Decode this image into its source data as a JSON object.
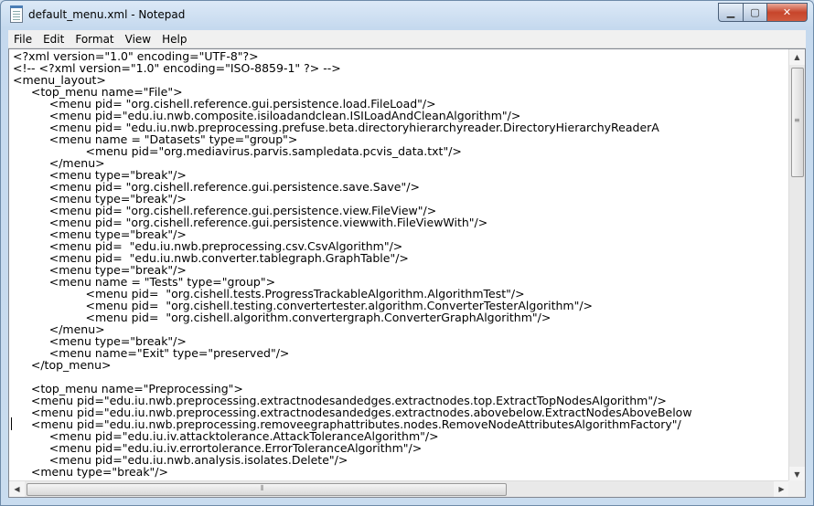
{
  "window": {
    "title": "default_menu.xml - Notepad"
  },
  "titlebar_buttons": {
    "minimize": "▁",
    "maximize": "▢",
    "close": "✕"
  },
  "menubar": {
    "items": [
      "File",
      "Edit",
      "Format",
      "View",
      "Help"
    ]
  },
  "editor": {
    "lines": [
      "<?xml version=\"1.0\" encoding=\"UTF-8\"?>",
      "<!-- <?xml version=\"1.0\" encoding=\"ISO-8859-1\" ?> -->",
      "<menu_layout>",
      "     <top_menu name=\"File\">",
      "          <menu pid= \"org.cishell.reference.gui.persistence.load.FileLoad\"/>",
      "          <menu pid=\"edu.iu.nwb.composite.isiloadandclean.ISILoadAndCleanAlgorithm\"/>",
      "          <menu pid= \"edu.iu.nwb.preprocessing.prefuse.beta.directoryhierarchyreader.DirectoryHierarchyReaderA",
      "          <menu name = \"Datasets\" type=\"group\">",
      "                    <menu pid=\"org.mediavirus.parvis.sampledata.pcvis_data.txt\"/>",
      "          </menu>",
      "          <menu type=\"break\"/>",
      "          <menu pid= \"org.cishell.reference.gui.persistence.save.Save\"/>",
      "          <menu type=\"break\"/>",
      "          <menu pid= \"org.cishell.reference.gui.persistence.view.FileView\"/>",
      "          <menu pid= \"org.cishell.reference.gui.persistence.viewwith.FileViewWith\"/>",
      "          <menu type=\"break\"/>",
      "          <menu pid=  \"edu.iu.nwb.preprocessing.csv.CsvAlgorithm\"/>",
      "          <menu pid=  \"edu.iu.nwb.converter.tablegraph.GraphTable\"/>",
      "          <menu type=\"break\"/>",
      "          <menu name = \"Tests\" type=\"group\">",
      "                    <menu pid=  \"org.cishell.tests.ProgressTrackableAlgorithm.AlgorithmTest\"/>",
      "                    <menu pid=  \"org.cishell.testing.convertertester.algorithm.ConverterTesterAlgorithm\"/>",
      "                    <menu pid=  \"org.cishell.algorithm.convertergraph.ConverterGraphAlgorithm\"/>",
      "          </menu>",
      "          <menu type=\"break\"/>",
      "          <menu name=\"Exit\" type=\"preserved\"/>",
      "     </top_menu>",
      "",
      "     <top_menu name=\"Preprocessing\">",
      "     <menu pid=\"edu.iu.nwb.preprocessing.extractnodesandedges.extractnodes.top.ExtractTopNodesAlgorithm\"/>",
      "     <menu pid=\"edu.iu.nwb.preprocessing.extractnodesandedges.extractnodes.abovebelow.ExtractNodesAboveBelow",
      "     <menu pid=\"edu.iu.nwb.preprocessing.removeegraphattributes.nodes.RemoveNodeAttributesAlgorithmFactory\"/",
      "          <menu pid=\"edu.iu.iv.attacktolerance.AttackToleranceAlgorithm\"/>",
      "          <menu pid=\"edu.iu.iv.errortolerance.ErrorToleranceAlgorithm\"/>",
      "          <menu pid=\"edu.iu.nwb.analysis.isolates.Delete\"/>",
      "     <menu type=\"break\"/>"
    ]
  }
}
